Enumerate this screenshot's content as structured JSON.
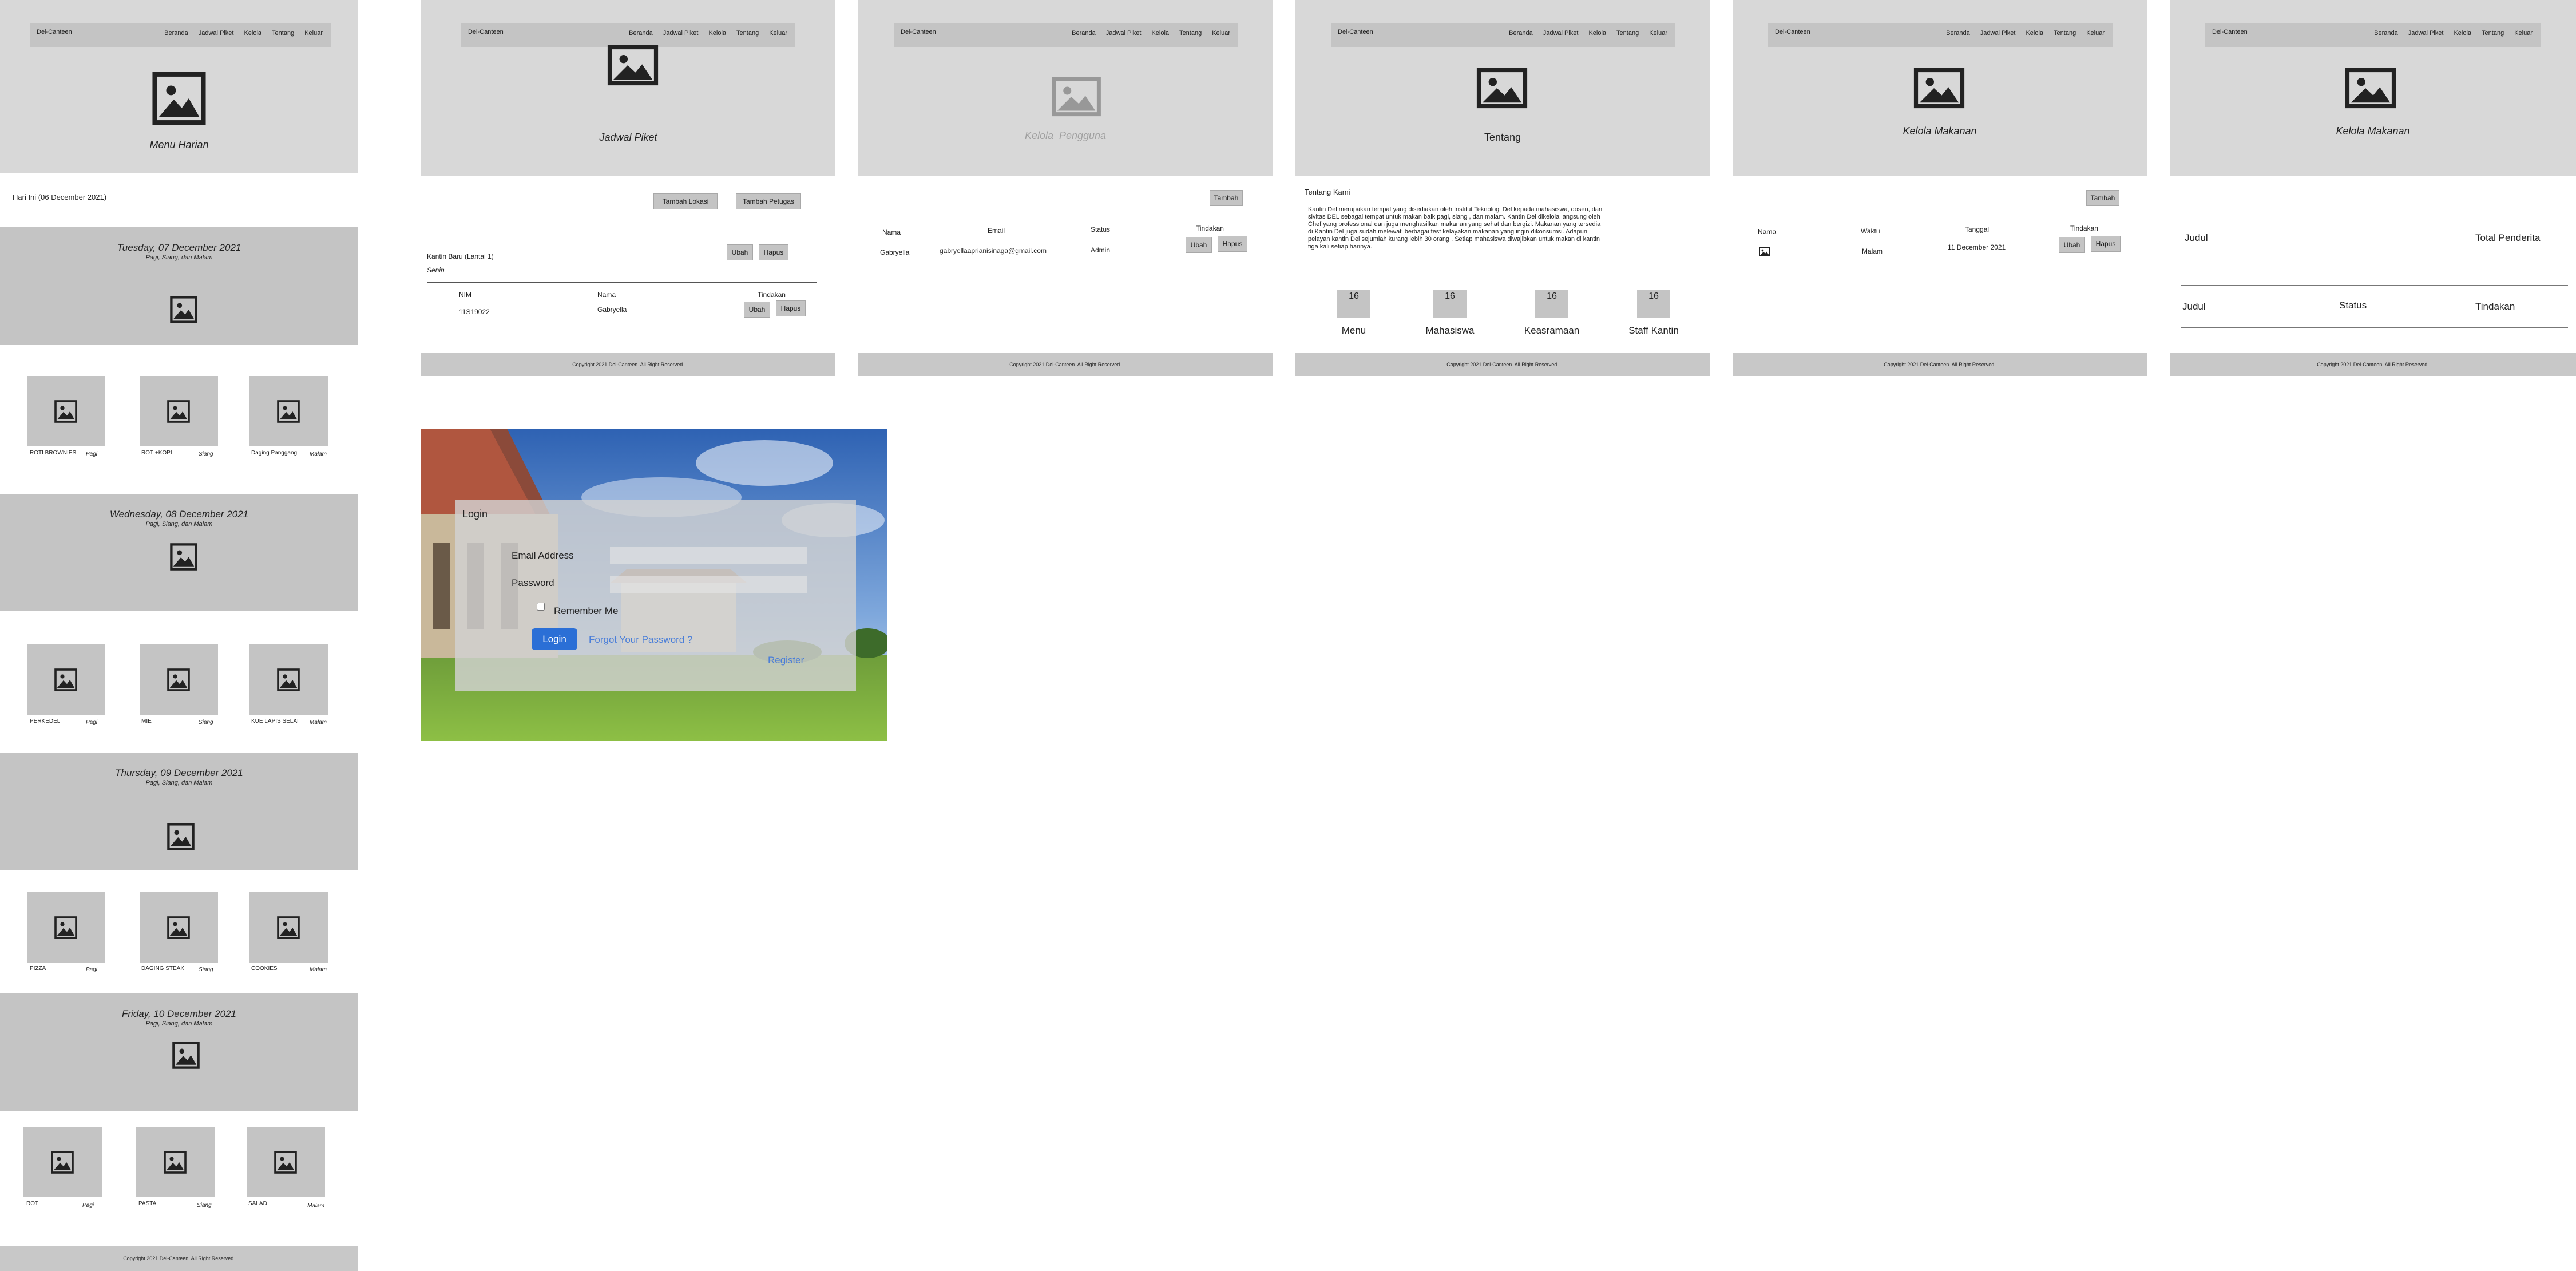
{
  "nav": {
    "brand": "Del-Canteen",
    "links": [
      "Beranda",
      "Jadwal Piket",
      "Kelola",
      "Tentang",
      "Keluar"
    ]
  },
  "footer": "Copyright 2021 Del-Canteen. All Right Reserved.",
  "menu_harian": {
    "hero_title": "Menu Harian",
    "today_label": "Hari Ini (06 December 2021)",
    "days": [
      {
        "title": "Tuesday, 07 December 2021",
        "subtitle": "Pagi, Siang, dan Malam",
        "foods": [
          {
            "name": "ROTI BROWNIES",
            "time": "Pagi"
          },
          {
            "name": "ROTI+KOPI",
            "time": "Siang"
          },
          {
            "name": "Daging Panggang",
            "time": "Malam"
          }
        ]
      },
      {
        "title": "Wednesday, 08 December 2021",
        "subtitle": "Pagi, Siang, dan Malam",
        "foods": [
          {
            "name": "PERKEDEL",
            "time": "Pagi"
          },
          {
            "name": "MIE",
            "time": "Siang"
          },
          {
            "name": "KUE LAPIS SELAI",
            "time": "Malam"
          }
        ]
      },
      {
        "title": "Thursday, 09 December 2021",
        "subtitle": "Pagi, Siang, dan Malam",
        "foods": [
          {
            "name": "PIZZA",
            "time": "Pagi"
          },
          {
            "name": "DAGING STEAK",
            "time": "Siang"
          },
          {
            "name": "COOKIES",
            "time": "Malam"
          }
        ]
      },
      {
        "title": "Friday, 10 December 2021",
        "subtitle": "Pagi, Siang, dan Malam",
        "foods": [
          {
            "name": "ROTI",
            "time": "Pagi"
          },
          {
            "name": "PASTA",
            "time": "Siang"
          },
          {
            "name": "SALAD",
            "time": "Malam"
          }
        ]
      }
    ]
  },
  "jadwal_piket": {
    "hero_title": "Jadwal Piket",
    "btn_tambah_lokasi": "Tambah Lokasi",
    "btn_tambah_petugas": "Tambah Petugas",
    "location": "Kantin Baru (Lantai 1)",
    "day": "Senin",
    "btn_ubah": "Ubah",
    "btn_hapus": "Hapus",
    "columns": [
      "NIM",
      "Nama",
      "Tindakan"
    ],
    "rows": [
      {
        "nim": "11S19022",
        "nama": "Gabryella"
      }
    ]
  },
  "kelola_pengguna": {
    "hero_title": "Kelola  Pengguna",
    "btn_tambah": "Tambah",
    "columns": [
      "Nama",
      "Email",
      "Status",
      "Tindakan"
    ],
    "rows": [
      {
        "nama": "Gabryella",
        "email": "gabryellaaprianisinaga@gmail.com",
        "status": "Admin"
      }
    ],
    "btn_ubah": "Ubah",
    "btn_hapus": "Hapus"
  },
  "tentang": {
    "hero_title": "Tentang",
    "section_title": "Tentang Kami",
    "paragraph": "Kantin Del merupakan tempat yang disediakan oleh Institut Teknologi Del kepada mahasiswa, dosen, dan sivitas DEL sebagai tempat untuk makan baik pagi, siang , dan malam. Kantin Del dikelola langsung oleh Chef yang professional dan juga menghasilkan makanan yang sehat dan bergizi. Makanan yang tersedia di Kantin Del juga sudah melewati berbagai test kelayakan makanan yang ingin dikonsumsi. Adapun pelayan kantin Del sejumlah kurang lebih 30 orang . Setiap mahasiswa diwajibkan untuk makan di kantin tiga kali setiap harinya.",
    "stats": [
      {
        "value": "16",
        "label": "Menu"
      },
      {
        "value": "16",
        "label": "Mahasiswa"
      },
      {
        "value": "16",
        "label": "Keasramaan"
      },
      {
        "value": "16",
        "label": "Staff Kantin"
      }
    ]
  },
  "kelola_makanan_1": {
    "hero_title": "Kelola Makanan",
    "btn_tambah": "Tambah",
    "columns": [
      "Nama",
      "Waktu",
      "Tanggal",
      "Tindakan"
    ],
    "rows": [
      {
        "waktu": "Malam",
        "tanggal": "11 December 2021"
      }
    ],
    "btn_ubah": "Ubah",
    "btn_hapus": "Hapus"
  },
  "kelola_makanan_2": {
    "hero_title": "Kelola Makanan",
    "row1": [
      "Judul",
      "Total Penderita"
    ],
    "row2": [
      "Judul",
      "Status",
      "Tindakan"
    ]
  },
  "login": {
    "title": "Login",
    "email_label": "Email Address",
    "password_label": "Password",
    "remember_label": "Remember Me",
    "login_button": "Login",
    "forgot_link": "Forgot Your Password ?",
    "register_link": "Register",
    "colors": {
      "primary": "#2b6fd6",
      "link": "#4a7ed8"
    }
  }
}
